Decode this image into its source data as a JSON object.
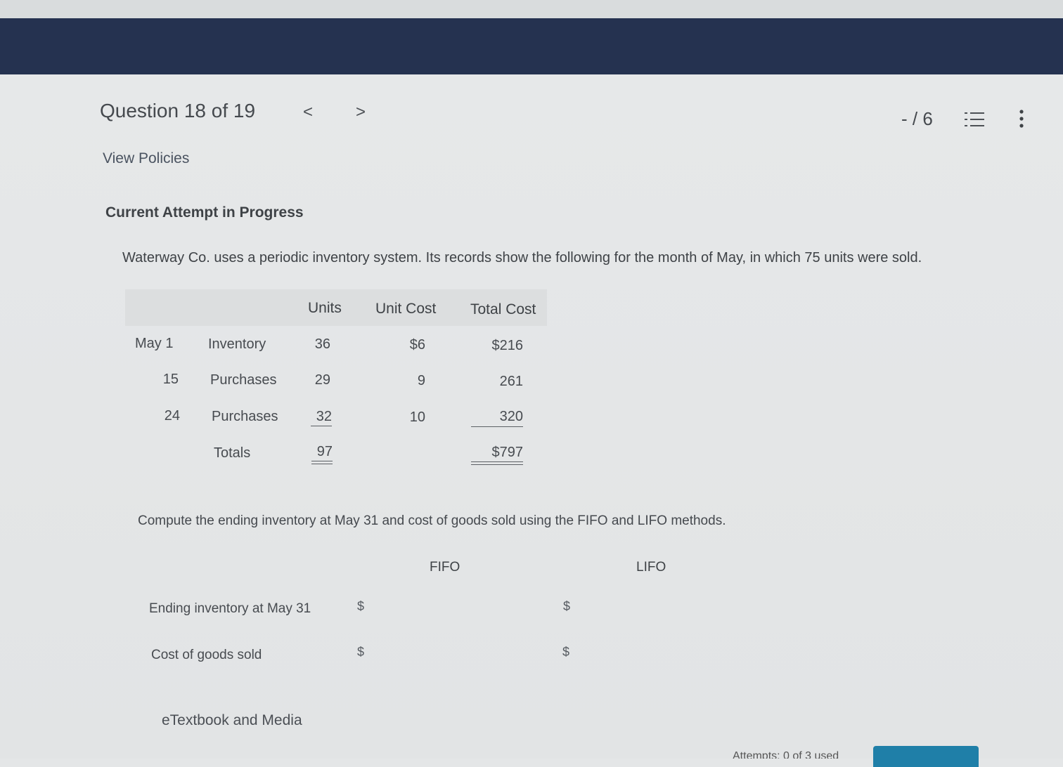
{
  "header": {
    "question_label": "Question 18 of 19",
    "prev_glyph": "<",
    "next_glyph": ">",
    "score": "- / 6"
  },
  "links": {
    "view_policies": "View Policies",
    "etextbook": "eTextbook and Media"
  },
  "attempt_label": "Current Attempt in Progress",
  "problem_text": "Waterway Co. uses a periodic inventory system. Its records show the following for the month of May, in which 75 units were sold.",
  "inventory_table": {
    "headers": [
      "Units",
      "Unit Cost",
      "Total Cost"
    ],
    "rows": [
      {
        "date": "May 1",
        "desc": "Inventory",
        "units": "36",
        "unit_cost": "$6",
        "total": "$216"
      },
      {
        "date": "15",
        "desc": "Purchases",
        "units": "29",
        "unit_cost": "9",
        "total": "261"
      },
      {
        "date": "24",
        "desc": "Purchases",
        "units": "32",
        "unit_cost": "10",
        "total": "320"
      }
    ],
    "totals": {
      "label": "Totals",
      "units": "97",
      "total": "$797"
    }
  },
  "instruction": "Compute the ending inventory at May 31 and cost of goods sold using the FIFO and LIFO methods.",
  "answer_grid": {
    "columns": [
      "FIFO",
      "LIFO"
    ],
    "rows": [
      {
        "label": "Ending inventory at May 31",
        "currency": "$",
        "fifo": "",
        "lifo": ""
      },
      {
        "label": "Cost of goods sold",
        "currency": "$",
        "fifo": "",
        "lifo": ""
      }
    ]
  },
  "footer": {
    "attempts_text": "Attempts: 0 of 3 used"
  },
  "icons": {
    "list": "list-icon",
    "more": "more-vertical-icon"
  },
  "colors": {
    "banner": "#253250",
    "button": "#1f7fa8"
  }
}
